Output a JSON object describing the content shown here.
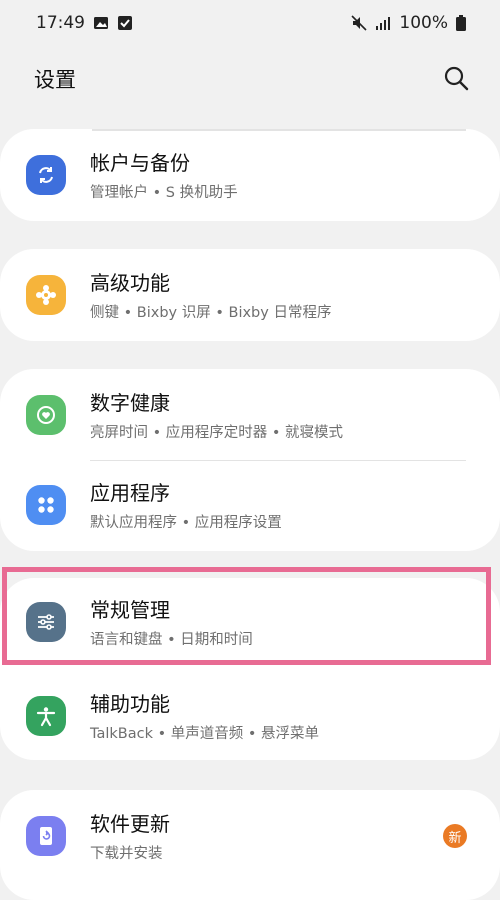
{
  "status_bar": {
    "time": "17:49",
    "battery": "100%",
    "icons": [
      "image-icon",
      "check-box-icon",
      "mute-icon",
      "signal-icon",
      "battery-icon"
    ]
  },
  "header": {
    "title": "设置",
    "search_icon": "search-icon"
  },
  "items": [
    {
      "title": "帐户与备份",
      "subtitle": "管理帐户 • S 换机助手",
      "icon": "sync-icon",
      "color": "#3e6fdc"
    },
    {
      "title": "高级功能",
      "subtitle": "侧键 • Bixby 识屏 • Bixby 日常程序",
      "icon": "puzzle-gear-icon",
      "color": "#f6b43b"
    },
    {
      "title": "数字健康",
      "subtitle": "亮屏时间 • 应用程序定时器 • 就寝模式",
      "icon": "wellbeing-heart-icon",
      "color": "#5cbf6d"
    },
    {
      "title": "应用程序",
      "subtitle": "默认应用程序 • 应用程序设置",
      "icon": "apps-grid-icon",
      "color": "#4f8ef2"
    },
    {
      "title": "常规管理",
      "subtitle": "语言和键盘 • 日期和时间",
      "icon": "sliders-icon",
      "color": "#56728a"
    },
    {
      "title": "辅助功能",
      "subtitle": "TalkBack • 单声道音频 • 悬浮菜单",
      "icon": "accessibility-icon",
      "color": "#34a35f"
    },
    {
      "title": "软件更新",
      "subtitle": "下载并安装",
      "icon": "software-update-icon",
      "color": "#7b7ff0",
      "badge": "新"
    }
  ],
  "colors": {
    "background": "#f1f1f1",
    "card": "#ffffff",
    "highlight": "#e86b93",
    "badge": "#ea7a24"
  }
}
